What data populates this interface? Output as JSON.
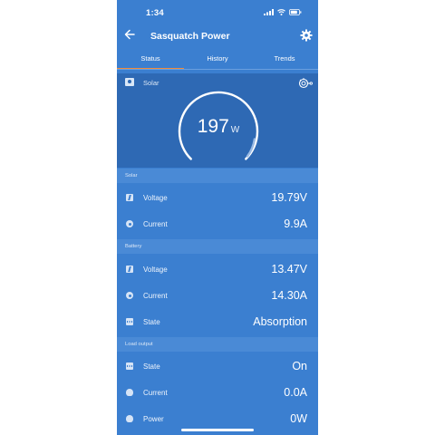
{
  "status_bar": {
    "time": "1:34"
  },
  "app_bar": {
    "title": "Sasquatch Power"
  },
  "tabs": [
    {
      "label": "Status",
      "active": true
    },
    {
      "label": "History",
      "active": false
    },
    {
      "label": "Trends",
      "active": false
    }
  ],
  "hero": {
    "label": "Solar",
    "power_value": "197",
    "power_unit": "W"
  },
  "sections": {
    "solar": {
      "header": "Solar",
      "voltage": {
        "label": "Voltage",
        "value": "19.79V"
      },
      "current": {
        "label": "Current",
        "value": "9.9A"
      }
    },
    "battery": {
      "header": "Battery",
      "voltage": {
        "label": "Voltage",
        "value": "13.47V"
      },
      "current": {
        "label": "Current",
        "value": "14.30A"
      },
      "state": {
        "label": "State",
        "value": "Absorption"
      }
    },
    "load_output": {
      "header": "Load output",
      "state": {
        "label": "State",
        "value": "On"
      },
      "current": {
        "label": "Current",
        "value": "0.0A"
      },
      "power": {
        "label": "Power",
        "value": "0W"
      }
    }
  },
  "colors": {
    "background": "#3b7fd0",
    "hero_background": "#2e69b4",
    "section_header": "#4a8ad6",
    "tab_indicator": "#f08a3b"
  },
  "icons": [
    "back-arrow-icon",
    "gear-icon",
    "solar-panel-icon",
    "link-icon",
    "bolt-icon",
    "gauge-icon",
    "dots-icon",
    "bulb-icon"
  ]
}
